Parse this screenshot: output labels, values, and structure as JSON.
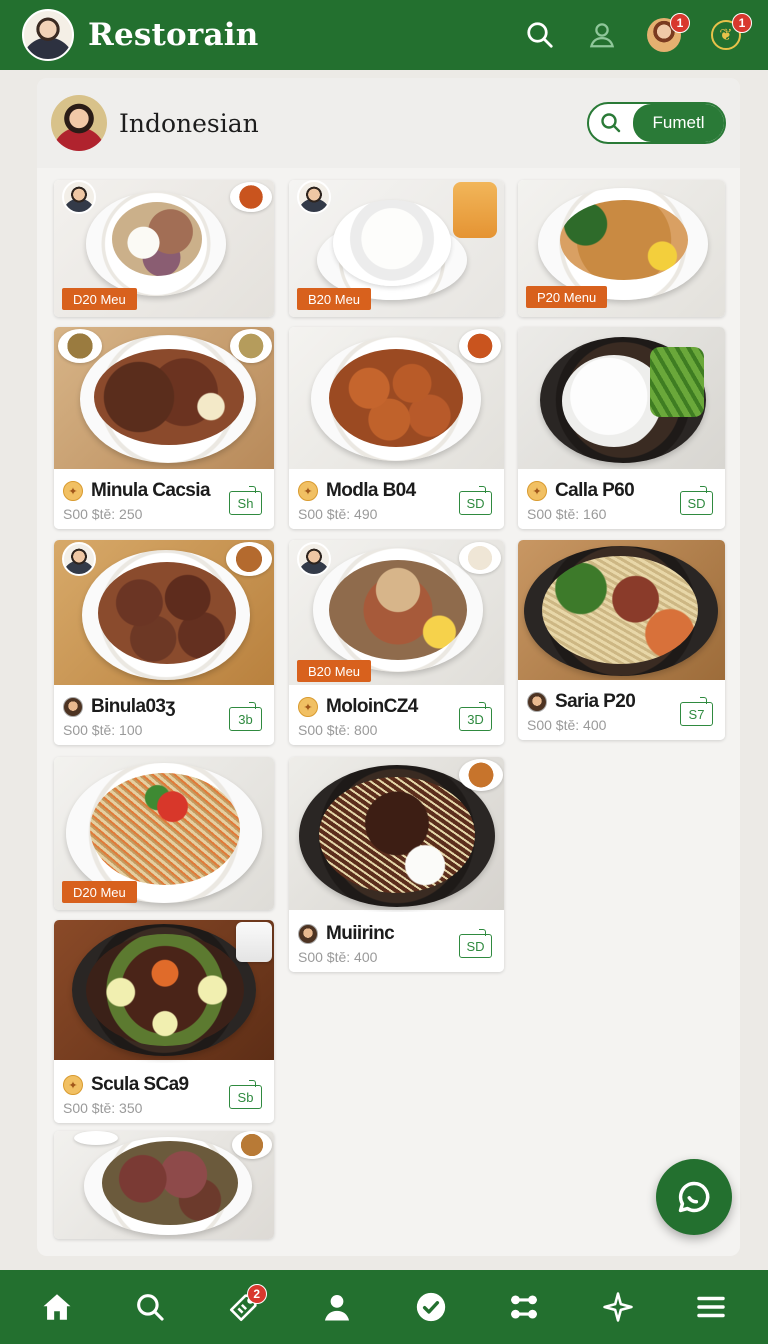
{
  "app": {
    "title": "Restorain",
    "notifications": {
      "profile_badge": "1",
      "rewards_badge": "1"
    }
  },
  "category": {
    "title": "Indonesian",
    "filter_label": "Fumetl"
  },
  "cards": [
    {
      "tag": "D20 Meu"
    },
    {
      "tag": "B20 Meu"
    },
    {
      "tag": "P20 Menu"
    },
    {
      "name": "Minula Cacsia",
      "price": "S00 $tĕ: 250",
      "cart": "Sh"
    },
    {
      "name": "Modla B04",
      "price": "S00 $tĕ: 490",
      "cart": "SD"
    },
    {
      "name": "Calla P60",
      "price": "S00 $tĕ: 160",
      "cart": "SD"
    },
    {
      "name": "Binula03ʒ",
      "price": "S00 $tĕ: 100",
      "cart": "3b"
    },
    {
      "name": "MoloinCZ4",
      "price": "S00 $tĕ: 800",
      "cart": "3D",
      "tag": "B20 Meu"
    },
    {
      "name": "Saria P20",
      "price": "S00 $tĕ: 400",
      "cart": "S7"
    },
    {
      "tag": "D20 Meu"
    },
    {
      "name": "Muiirinc",
      "price": "S00 $tĕ: 400",
      "cart": "SD"
    },
    {
      "name": "Scula SCa9",
      "price": "S00 $tĕ: 350",
      "cart": "Sb"
    },
    {}
  ],
  "bottom_nav": {
    "items": [
      "home-icon",
      "search-icon",
      "deals-icon",
      "profile-icon",
      "check-icon",
      "settings-icon",
      "star-icon",
      "menu-icon"
    ],
    "deals_badge": "2"
  },
  "colors": {
    "brand_green": "#23702f",
    "tag_orange": "#d8611d",
    "badge_red": "#d8382e"
  }
}
